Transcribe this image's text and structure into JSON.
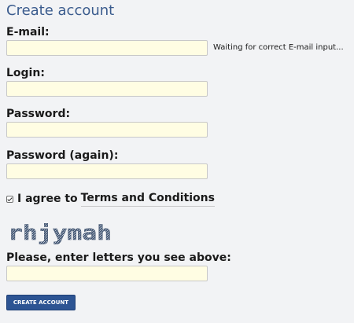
{
  "form": {
    "title": "Create account",
    "email": {
      "label": "E-mail:",
      "value": "",
      "placeholder": ""
    },
    "email_hint": "Waiting for correct E-mail input...",
    "login": {
      "label": "Login:",
      "value": "",
      "placeholder": ""
    },
    "password": {
      "label": "Password:",
      "value": "",
      "placeholder": ""
    },
    "password_again": {
      "label": "Password (again):",
      "value": "",
      "placeholder": ""
    },
    "agree": {
      "checked": true,
      "prefix": "I agree to",
      "link_text": "Terms and Conditions"
    },
    "captcha": {
      "text": "rhjymah",
      "label": "Please, enter letters you see above:",
      "value": ""
    },
    "submit_label": "CREATE ACCOUNT"
  },
  "colors": {
    "background": "#f2f3f5",
    "title": "#3b5c8e",
    "field_bg": "#fffde3",
    "button_bg": "#2d5493",
    "captcha_ink": "#4a5d79"
  }
}
